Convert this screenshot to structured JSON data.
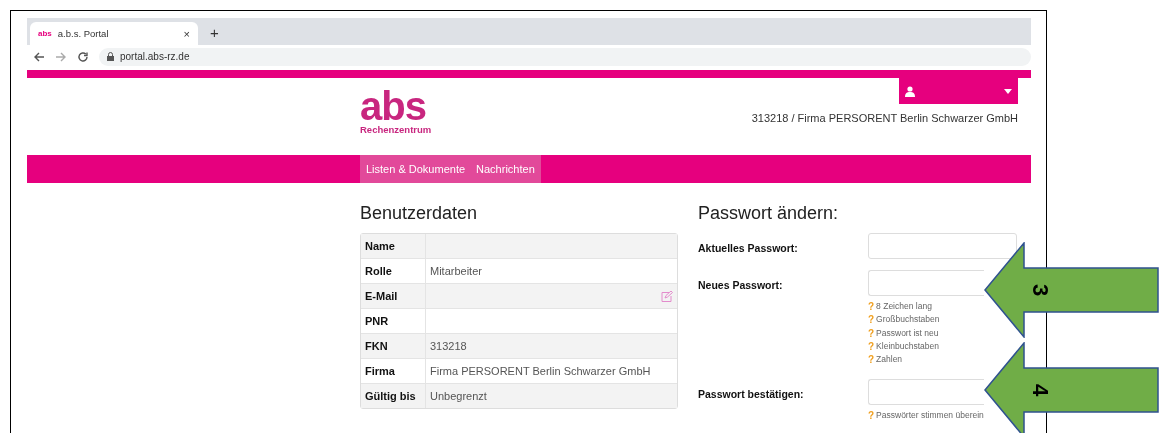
{
  "browser": {
    "tab": {
      "favicon": "abs",
      "title": "a.b.s. Portal",
      "close": "×"
    },
    "new_tab": "+",
    "url": "portal.abs-rz.de"
  },
  "header": {
    "logo": "abs",
    "logo_subtitle": "Rechenzentrum",
    "account": "313218 / Firma PERSORENT Berlin Schwarzer GmbH"
  },
  "nav": [
    {
      "label": "Listen & Dokumente"
    },
    {
      "label": "Nachrichten"
    }
  ],
  "user_data": {
    "title": "Benutzerdaten",
    "rows": [
      {
        "label": "Name"
      },
      {
        "label": "Rolle",
        "value": "Mitarbeiter"
      },
      {
        "label": "E-Mail",
        "editable": true
      },
      {
        "label": "PNR"
      },
      {
        "label": "FKN",
        "value": "313218"
      },
      {
        "label": "Firma",
        "value": "Firma PERSORENT Berlin Schwarzer GmbH"
      },
      {
        "label": "Gültig bis",
        "value": "Unbegrenzt"
      }
    ]
  },
  "password": {
    "title": "Passwort ändern:",
    "fields": [
      {
        "label": "Aktuelles Passwort:"
      },
      {
        "label": "Neues Passwort:",
        "hints": [
          {
            "icon": "?",
            "text": "8 Zeichen lang"
          },
          {
            "icon": "?",
            "text": "Großbuchstaben"
          },
          {
            "icon": "?",
            "text": "Passwort ist neu"
          },
          {
            "icon": "?",
            "text": "Kleinbuchstaben"
          },
          {
            "icon": "?",
            "text": "Zahlen"
          }
        ]
      },
      {
        "label": "Passwort bestätigen:",
        "hints": [
          {
            "icon": "?",
            "text": "Passwörter stimmen überein"
          }
        ]
      }
    ]
  },
  "annotations": [
    {
      "label": "3"
    },
    {
      "label": "4"
    }
  ]
}
